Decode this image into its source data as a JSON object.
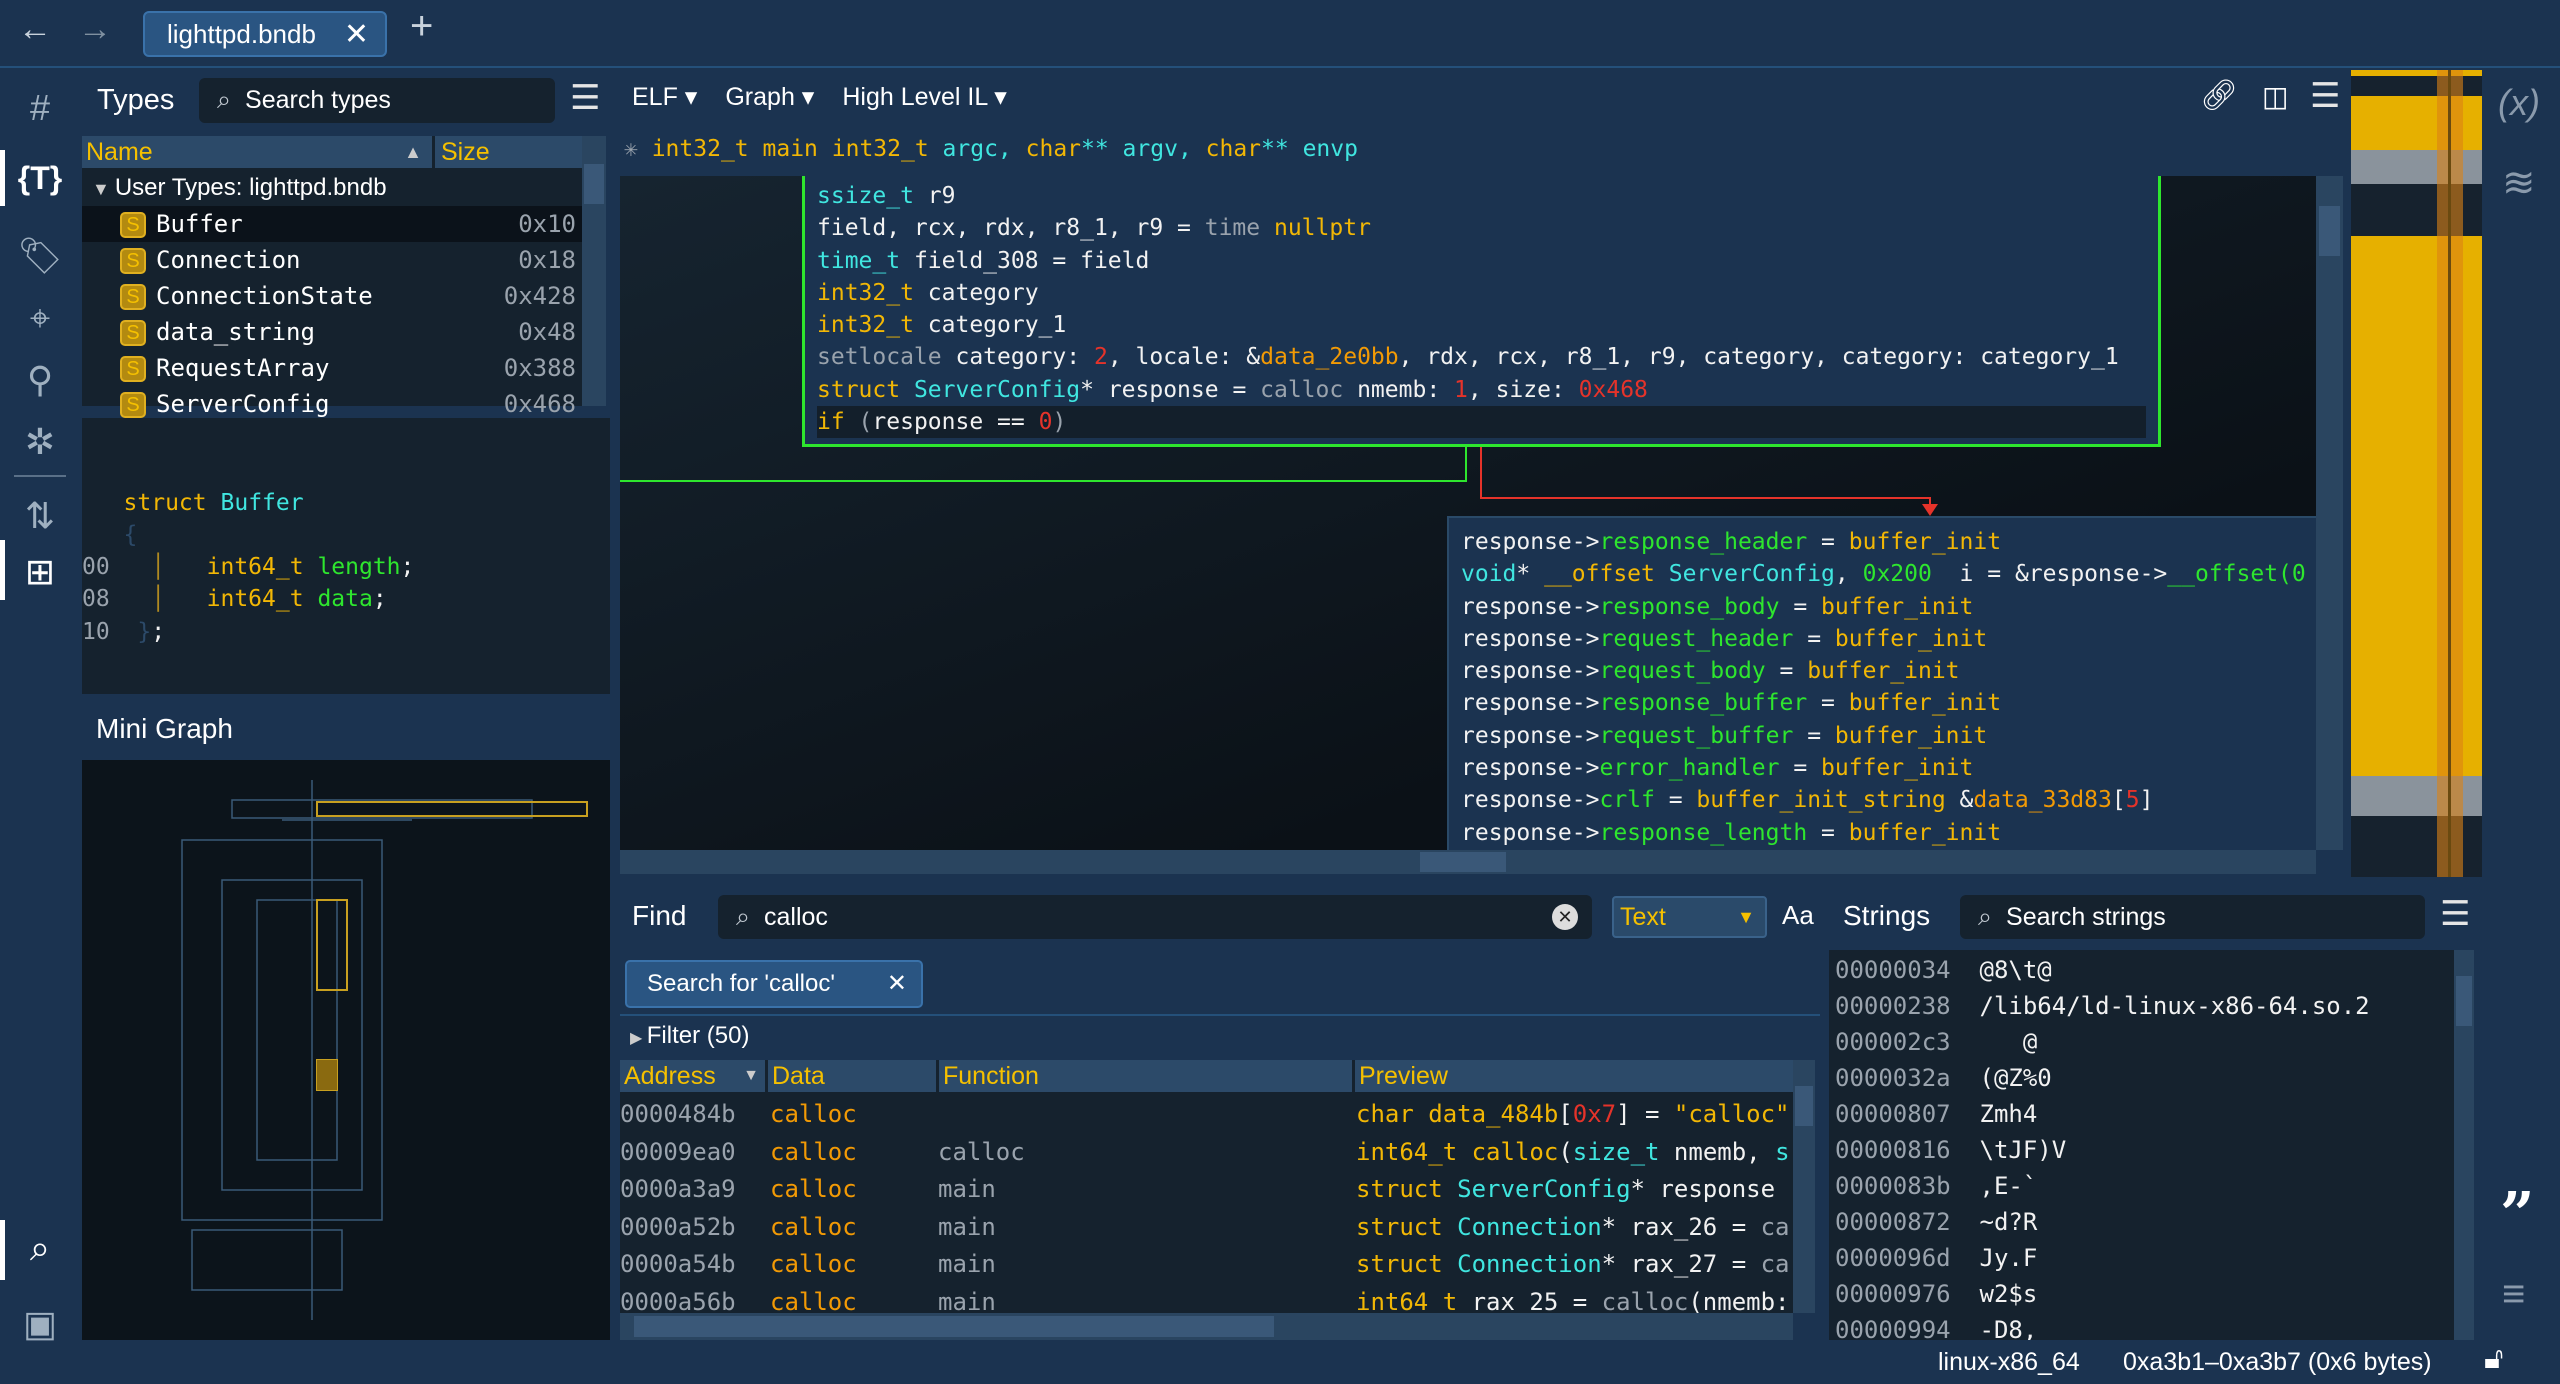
{
  "tabbar": {
    "tab_title": "lighttpd.bndb",
    "close": "✕",
    "new_tab": "+",
    "back": "←",
    "forward": "→"
  },
  "sidebar": {
    "icons": [
      "symbols-icon",
      "types-icon",
      "tags-icon",
      "location-icon",
      "graph-nodes-icon",
      "debugger-icon",
      "transfer-icon",
      "hierarchy-icon",
      "search-icon",
      "terminal-icon"
    ]
  },
  "types": {
    "title": "Types",
    "search_placeholder": "Search types",
    "col_name": "Name",
    "col_size": "Size",
    "group": "User Types: lighttpd.bndb",
    "items": [
      {
        "name": "Buffer",
        "size": "0x10"
      },
      {
        "name": "Connection",
        "size": "0x18"
      },
      {
        "name": "ConnectionState",
        "size": "0x428"
      },
      {
        "name": "data_string",
        "size": "0x48"
      },
      {
        "name": "RequestArray",
        "size": "0x388"
      },
      {
        "name": "ServerConfig",
        "size": "0x468"
      }
    ],
    "badge": "S",
    "struct_view": {
      "header": [
        [
          "struct",
          "k"
        ],
        [
          " ",
          "w"
        ],
        [
          "Buffer",
          "c"
        ]
      ],
      "open": "{",
      "close": "}",
      "semi": ";",
      "fields": [
        {
          "offset": "00",
          "type": "int64_t",
          "name": "length"
        },
        {
          "offset": "08",
          "type": "int64_t",
          "name": "data"
        }
      ],
      "end_offset": "10"
    }
  },
  "mini_graph": {
    "title": "Mini Graph"
  },
  "main": {
    "menus": [
      "ELF",
      "Graph",
      "High Level IL"
    ],
    "signature": [
      [
        "int32_t",
        "k"
      ],
      [
        " ",
        "w"
      ],
      [
        "main",
        "k"
      ],
      [
        " ",
        "w"
      ],
      [
        "int32_t",
        "k"
      ],
      [
        " argc, ",
        "c"
      ],
      [
        "char",
        "k"
      ],
      [
        "** argv, ",
        "c"
      ],
      [
        "char",
        "k"
      ],
      [
        "** envp",
        "c"
      ]
    ],
    "block1": [
      [
        [
          "ssize_t",
          "c"
        ],
        [
          " r9",
          "w"
        ]
      ],
      [
        [
          "field, rcx, rdx, r8_1, r9 = ",
          "w"
        ],
        [
          "time",
          "d"
        ],
        [
          " ",
          "w"
        ],
        [
          "nullptr",
          "k"
        ]
      ],
      [
        [
          "time_t",
          "c"
        ],
        [
          " field_308 = field",
          "w"
        ]
      ],
      [
        [
          "int32_t",
          "k"
        ],
        [
          " category",
          "w"
        ]
      ],
      [
        [
          "int32_t",
          "k"
        ],
        [
          " category_1",
          "w"
        ]
      ],
      [
        [
          "setlocale",
          "d"
        ],
        [
          " category: ",
          "w"
        ],
        [
          "2",
          "n"
        ],
        [
          ", locale: &",
          "w"
        ],
        [
          "data_2e0bb",
          "o"
        ],
        [
          ", rdx, rcx, r8_1, r9, category, category: category_1",
          "w"
        ]
      ],
      [
        [
          "struct",
          "k"
        ],
        [
          " ",
          "w"
        ],
        [
          "ServerConfig",
          "c"
        ],
        [
          "* response = ",
          "w"
        ],
        [
          "calloc",
          "d"
        ],
        [
          " nmemb: ",
          "w"
        ],
        [
          "1",
          "n"
        ],
        [
          ", size: ",
          "w"
        ],
        [
          "0x468",
          "n"
        ]
      ],
      [
        [
          "if",
          "k"
        ],
        [
          " (",
          "d"
        ],
        [
          "response == ",
          "w"
        ],
        [
          "0",
          "n"
        ],
        [
          ")",
          "d"
        ]
      ]
    ],
    "block2": [
      [
        [
          "response->",
          "w"
        ],
        [
          "response_header",
          "g"
        ],
        [
          " = ",
          "w"
        ],
        [
          "buffer_init",
          "k"
        ]
      ],
      [
        [
          "void",
          "c"
        ],
        [
          "* ",
          "w"
        ],
        [
          "__offset",
          "k"
        ],
        [
          " ",
          "w"
        ],
        [
          "ServerConfig",
          "c"
        ],
        [
          ", ",
          "w"
        ],
        [
          "0x200",
          "g"
        ],
        [
          "  i = &response->",
          "w"
        ],
        [
          "__offset(0",
          "g"
        ]
      ],
      [
        [
          "response->",
          "w"
        ],
        [
          "response_body",
          "g"
        ],
        [
          " = ",
          "w"
        ],
        [
          "buffer_init",
          "k"
        ]
      ],
      [
        [
          "response->",
          "w"
        ],
        [
          "request_header",
          "g"
        ],
        [
          " = ",
          "w"
        ],
        [
          "buffer_init",
          "k"
        ]
      ],
      [
        [
          "response->",
          "w"
        ],
        [
          "request_body",
          "g"
        ],
        [
          " = ",
          "w"
        ],
        [
          "buffer_init",
          "k"
        ]
      ],
      [
        [
          "response->",
          "w"
        ],
        [
          "response_buffer",
          "g"
        ],
        [
          " = ",
          "w"
        ],
        [
          "buffer_init",
          "k"
        ]
      ],
      [
        [
          "response->",
          "w"
        ],
        [
          "request_buffer",
          "g"
        ],
        [
          " = ",
          "w"
        ],
        [
          "buffer_init",
          "k"
        ]
      ],
      [
        [
          "response->",
          "w"
        ],
        [
          "error_handler",
          "g"
        ],
        [
          " = ",
          "w"
        ],
        [
          "buffer_init",
          "k"
        ]
      ],
      [
        [
          "response->",
          "w"
        ],
        [
          "crlf",
          "g"
        ],
        [
          " = ",
          "w"
        ],
        [
          "buffer_init_string",
          "k"
        ],
        [
          " &",
          "w"
        ],
        [
          "data_33d83",
          "o"
        ],
        [
          "[",
          "w"
        ],
        [
          "5",
          "n"
        ],
        [
          "]",
          "w"
        ]
      ],
      [
        [
          "response->",
          "w"
        ],
        [
          "response_length",
          "g"
        ],
        [
          " = ",
          "w"
        ],
        [
          "buffer_init",
          "k"
        ]
      ]
    ]
  },
  "find": {
    "label": "Find",
    "query": "calloc",
    "mode": "Text",
    "case_label": "Aa",
    "chip": "Search for 'calloc'",
    "chip_close": "✕",
    "filter": "Filter (50)",
    "columns": [
      "Address",
      "Data",
      "Function",
      "Preview"
    ],
    "rows": [
      {
        "address": "0000484b",
        "data": "calloc",
        "function": "",
        "preview": [
          [
            "char",
            "k"
          ],
          [
            " ",
            "w"
          ],
          [
            "data_484b",
            "k"
          ],
          [
            "[",
            "w"
          ],
          [
            "0x7",
            "n"
          ],
          [
            "] = ",
            "w"
          ],
          [
            "\"calloc\"",
            "k"
          ]
        ]
      },
      {
        "address": "00009ea0",
        "data": "calloc",
        "function": "calloc",
        "preview": [
          [
            "int64_t",
            "k"
          ],
          [
            " ",
            "w"
          ],
          [
            "calloc",
            "k"
          ],
          [
            "(",
            "w"
          ],
          [
            "size_t",
            "c"
          ],
          [
            " nmemb, ",
            "w"
          ],
          [
            "s",
            "c"
          ]
        ]
      },
      {
        "address": "0000a3a9",
        "data": "calloc",
        "function": "main",
        "preview": [
          [
            "struct",
            "k"
          ],
          [
            " ",
            "w"
          ],
          [
            "ServerConfig",
            "c"
          ],
          [
            "* response",
            "w"
          ]
        ]
      },
      {
        "address": "0000a52b",
        "data": "calloc",
        "function": "main",
        "preview": [
          [
            "struct",
            "k"
          ],
          [
            " ",
            "w"
          ],
          [
            "Connection",
            "c"
          ],
          [
            "* rax_26 = ",
            "w"
          ],
          [
            "ca",
            "d"
          ]
        ]
      },
      {
        "address": "0000a54b",
        "data": "calloc",
        "function": "main",
        "preview": [
          [
            "struct",
            "k"
          ],
          [
            " ",
            "w"
          ],
          [
            "Connection",
            "c"
          ],
          [
            "* rax_27 = ",
            "w"
          ],
          [
            "ca",
            "d"
          ]
        ]
      },
      {
        "address": "0000a56b",
        "data": "calloc",
        "function": "main",
        "preview": [
          [
            "int64_t",
            "k"
          ],
          [
            " rax_25 = ",
            "w"
          ],
          [
            "calloc",
            "d"
          ],
          [
            "(nmemb:",
            "w"
          ]
        ]
      }
    ]
  },
  "strings": {
    "title": "Strings",
    "search_placeholder": "Search strings",
    "rows": [
      [
        "00000034",
        "@8\\t@"
      ],
      [
        "00000238",
        "/lib64/ld-linux-x86-64.so.2"
      ],
      [
        "000002c3",
        "   @"
      ],
      [
        "0000032a",
        "(@Z%0"
      ],
      [
        "00000807",
        "Zmh4"
      ],
      [
        "00000816",
        "\\tJF)V"
      ],
      [
        "0000083b",
        ",E-`"
      ],
      [
        "00000872",
        "~d?R"
      ],
      [
        "0000096d",
        "Jy.F"
      ],
      [
        "00000976",
        "w2$s"
      ],
      [
        "00000994",
        "-D8,"
      ]
    ]
  },
  "status": {
    "platform": "linux-x86_64",
    "selection": "0xa3b1–0xa3b7 (0x6 bytes)"
  },
  "colors": {
    "background": "#1b3350",
    "keyword": "#f2b705",
    "type": "#40e6e0",
    "field": "#2ee62e",
    "number": "#e5332a",
    "true_edge": "#2ee62e",
    "false_edge": "#e5332a"
  }
}
